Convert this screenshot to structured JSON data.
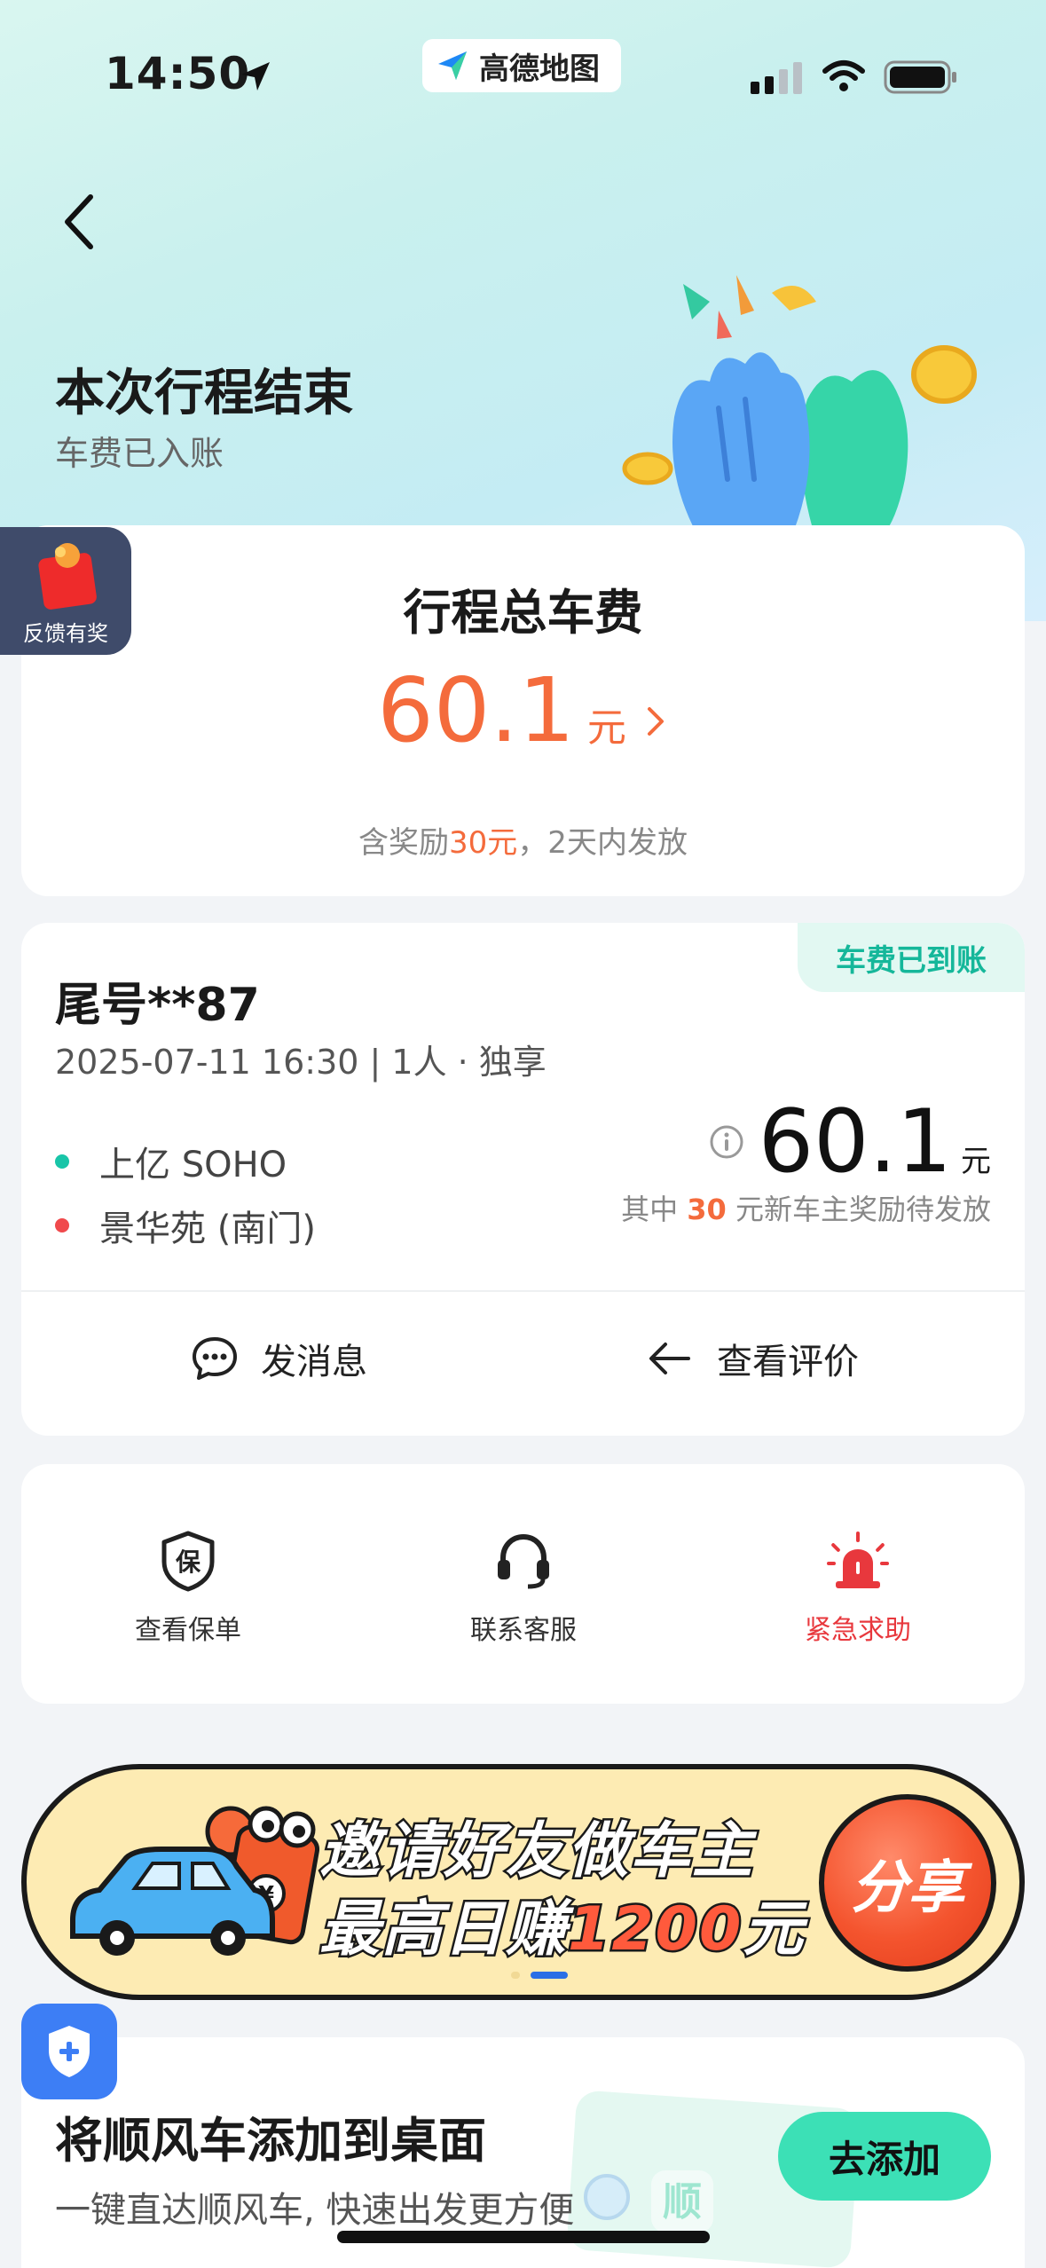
{
  "status_bar": {
    "time": "14:50",
    "app_name": "高德地图"
  },
  "header": {
    "title": "本次行程结束",
    "subtitle": "车费已入账"
  },
  "feedback": {
    "label": "反馈有奖"
  },
  "fare_card": {
    "title": "行程总车费",
    "amount": "60.1",
    "unit": "元",
    "note_prefix": "含奖励",
    "note_bonus": "30元",
    "note_suffix": "，2天内发放"
  },
  "trip": {
    "status_badge": "车费已到账",
    "plate": "尾号**87",
    "meta": "2025-07-11 16:30 | 1人 · 独享",
    "start": "上亿 SOHO",
    "end": "景华苑 (南门)",
    "price": "60.1",
    "unit": "元",
    "reward_prefix": "其中",
    "reward_amount": "30",
    "reward_suffix": "元新车主奖励待发放",
    "actions": [
      {
        "label": "发消息",
        "icon": "chat-icon"
      },
      {
        "label": "查看评价",
        "icon": "arrow-left-icon"
      }
    ]
  },
  "services": [
    {
      "label": "查看保单",
      "icon": "insurance-shield-icon"
    },
    {
      "label": "联系客服",
      "icon": "headset-icon"
    },
    {
      "label": "紧急求助",
      "icon": "alarm-icon"
    }
  ],
  "banner": {
    "line1": "邀请好友做车主",
    "line2_prefix": "最高日赚",
    "line2_number": "1200",
    "line2_suffix": "元",
    "share_label": "分享"
  },
  "desktop_card": {
    "title": "将顺风车添加到桌面",
    "subtitle": "一键直达顺风车, 快速出发更方便",
    "button": "去添加",
    "art_text": "顺"
  },
  "colors": {
    "accent_orange": "#f46b3c",
    "accent_green": "#15b79a",
    "alert_red": "#e8383d",
    "add_button": "#3ce0b6",
    "banner_bg": "#fdebb3"
  }
}
